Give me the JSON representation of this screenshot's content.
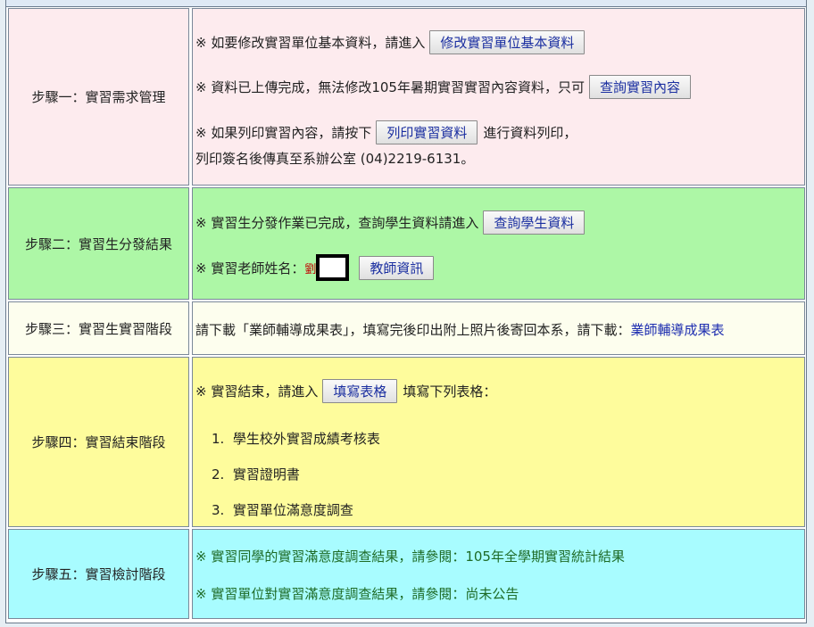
{
  "steps": [
    {
      "title": "步驟一：實習需求管理",
      "lines": {
        "l1_text": "※ 如要修改實習單位基本資料，請進入",
        "l1_button": "修改實習單位基本資料",
        "l2_text": "※ 資料已上傳完成，無法修改105年暑期實習實習內容資料，只可",
        "l2_button": "查詢實習內容",
        "l3_text": "※ 如果列印實習內容，請按下",
        "l3_button": "列印實習資料",
        "l3_after": "進行資料列印，",
        "l4_text": "列印簽名後傳真至系辦公室 (04)2219-6131。"
      }
    },
    {
      "title": "步驟二：實習生分發結果",
      "lines": {
        "l1_text": "※ 實習生分發作業已完成，查詢學生資料請進入",
        "l1_button": "查詢學生資料",
        "l2_text": "※ 實習老師姓名：",
        "l2_name": "劉",
        "l2_button": "教師資訊"
      }
    },
    {
      "title": "步驟三：實習生實習階段",
      "lines": {
        "l1_text": "請下載「業師輔導成果表」，填寫完後印出附上照片後寄回本系，請下載：",
        "l1_link": "業師輔導成果表"
      }
    },
    {
      "title": "步驟四：實習結束階段",
      "lines": {
        "l1_text": "※ 實習結束，請進入",
        "l1_button": "填寫表格",
        "l1_after": "填寫下列表格：",
        "items": [
          "學生校外實習成績考核表",
          "實習證明書",
          "實習單位滿意度調查"
        ]
      }
    },
    {
      "title": "步驟五：實習檢討階段",
      "lines": {
        "l1_text": "※ 實習同學的實習滿意度調查結果，請參閱：",
        "l1_link": "105年全學期實習統計結果",
        "l2_text": "※ 實習單位對實習滿意度調查結果，請參閱：",
        "l2_link": "尚未公告"
      }
    }
  ],
  "colors": {
    "step1": "#fdebee",
    "step2": "#adf7a6",
    "step3": "#fdfeee",
    "step4": "#fefc9c",
    "step5": "#a8fcff"
  }
}
